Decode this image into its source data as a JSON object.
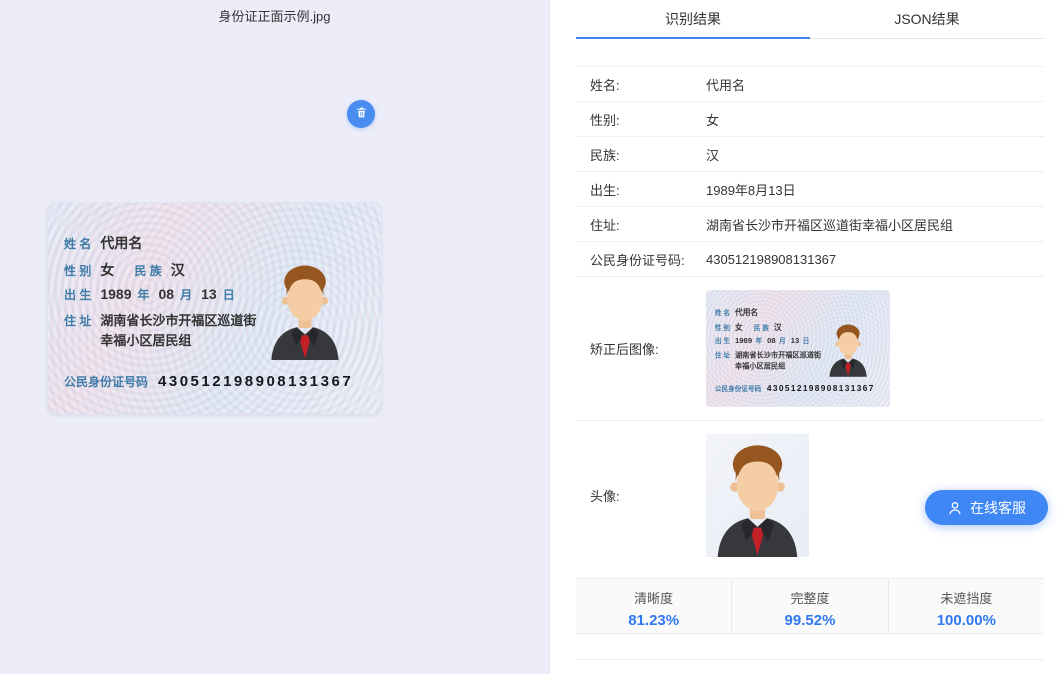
{
  "left_panel": {
    "filename": "身份证正面示例.jpg"
  },
  "card": {
    "name_label": "姓 名",
    "name_value": "代用名",
    "gender_label": "性 别",
    "gender_value": "女",
    "ethnic_label": "民 族",
    "ethnic_value": "汉",
    "birth_label": "出 生",
    "birth_year": "1989",
    "birth_year_char": "年",
    "birth_month": "08",
    "birth_month_char": "月",
    "birth_day": "13",
    "birth_day_char": "日",
    "address_label": "住 址",
    "address_line1": "湖南省长沙市开福区巡道街",
    "address_line2": "幸福小区居民组",
    "id_label": "公民身份证号码",
    "id_value": "430512198908131367"
  },
  "tabs": [
    {
      "label": "识别结果",
      "active": true
    },
    {
      "label": "JSON结果",
      "active": false
    }
  ],
  "results": {
    "rows": [
      {
        "label": "姓名:",
        "value": "代用名"
      },
      {
        "label": "性别:",
        "value": "女"
      },
      {
        "label": "民族:",
        "value": "汉"
      },
      {
        "label": "出生:",
        "value": "1989年8月13日"
      },
      {
        "label": "住址:",
        "value": "湖南省长沙市开福区巡道街幸福小区居民组"
      },
      {
        "label": "公民身份证号码:",
        "value": "430512198908131367"
      },
      {
        "label": "矫正后图像:",
        "value": ""
      },
      {
        "label": "头像:",
        "value": ""
      }
    ]
  },
  "stats": [
    {
      "label": "清晰度",
      "value": "81.23%"
    },
    {
      "label": "完整度",
      "value": "99.52%"
    },
    {
      "label": "未遮挡度",
      "value": "100.00%"
    }
  ],
  "floating_button": {
    "label": "在线客服"
  },
  "icons": {
    "delete": "trash-icon",
    "service": "person-headset-icon"
  },
  "colors": {
    "accent_blue": "#3f87f5",
    "tab_underline": "#4286f5",
    "card_label_teal": "#3f7ba8",
    "left_panel_bg": "#ecedf8"
  }
}
